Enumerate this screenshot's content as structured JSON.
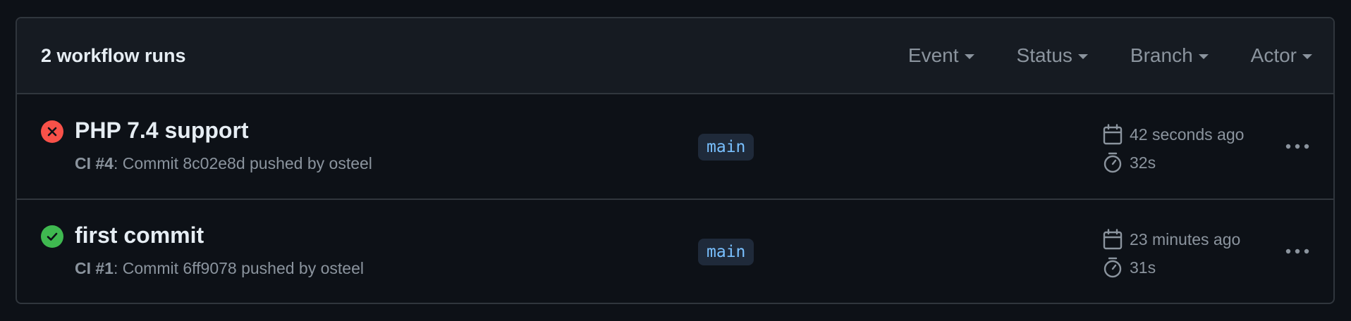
{
  "header": {
    "runs_count": "2 workflow runs",
    "filters": [
      {
        "label": "Event"
      },
      {
        "label": "Status"
      },
      {
        "label": "Branch"
      },
      {
        "label": "Actor"
      }
    ]
  },
  "runs": [
    {
      "status": "failure",
      "status_icon": "x-circle-icon",
      "title": "PHP 7.4 support",
      "workflow": "CI #4",
      "details": ": Commit 8c02e8d pushed by osteel",
      "branch": "main",
      "time_ago": "42 seconds ago",
      "duration": "32s"
    },
    {
      "status": "success",
      "status_icon": "check-circle-icon",
      "title": "first commit",
      "workflow": "CI #1",
      "details": ": Commit 6ff9078 pushed by osteel",
      "branch": "main",
      "time_ago": "23 minutes ago",
      "duration": "31s"
    }
  ],
  "colors": {
    "background": "#0d1117",
    "header_background": "#161b22",
    "border": "#30363d",
    "failure": "#f85149",
    "success": "#3fb950",
    "branch_text": "#79c0ff",
    "muted_text": "#8b949e"
  }
}
